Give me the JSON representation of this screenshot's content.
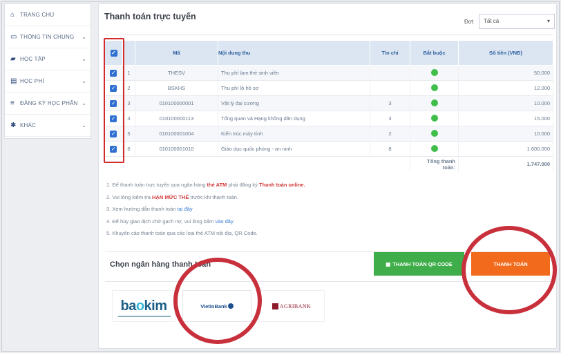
{
  "sidebar": {
    "items": [
      {
        "label": "TRANG CHỦ",
        "icon": "home-icon",
        "glyph": "⌂",
        "has_chevron": false
      },
      {
        "label": "THÔNG TIN CHUNG",
        "icon": "monitor-icon",
        "glyph": "▭",
        "has_chevron": true
      },
      {
        "label": "HỌC TẬP",
        "icon": "graduation-cap-icon",
        "glyph": "▰",
        "has_chevron": true
      },
      {
        "label": "HỌC PHÍ",
        "icon": "money-icon",
        "glyph": "▤",
        "has_chevron": true
      },
      {
        "label": "ĐĂNG KÝ HỌC PHẦN",
        "icon": "list-icon",
        "glyph": "≡",
        "has_chevron": true
      },
      {
        "label": "KHÁC",
        "icon": "gear-icon",
        "glyph": "✱",
        "has_chevron": true
      }
    ]
  },
  "page": {
    "title": "Thanh toán trực tuyến",
    "filter_label": "Đợt",
    "filter_value": "Tất cả"
  },
  "table": {
    "headers": [
      "",
      "",
      "Mã",
      "Nội dung thu",
      "Tín chỉ",
      "Bắt buộc",
      "Số tiền (VNĐ)"
    ],
    "rows": [
      {
        "stt": "1",
        "ma": "THESV",
        "noidung": "Thu phí làm thẻ sinh viên",
        "tinchi": "",
        "batbuoc": true,
        "sotien": "50.000"
      },
      {
        "stt": "2",
        "ma": "BSKHS",
        "noidung": "Thu phí lồ hồ sơ",
        "tinchi": "",
        "batbuoc": true,
        "sotien": "12.000"
      },
      {
        "stt": "3",
        "ma": "010100000001",
        "noidung": "Vật lý đại cương",
        "tinchi": "3",
        "batbuoc": true,
        "sotien": "10.000"
      },
      {
        "stt": "4",
        "ma": "010100000113",
        "noidung": "Tổng quan và Hạng không dân dụng",
        "tinchi": "3",
        "batbuoc": true,
        "sotien": "15.000"
      },
      {
        "stt": "5",
        "ma": "010100001004",
        "noidung": "Kiến trúc máy tính",
        "tinchi": "2",
        "batbuoc": true,
        "sotien": "10.000"
      },
      {
        "stt": "6",
        "ma": "010100001010",
        "noidung": "Giáo dục quốc phòng - an ninh",
        "tinchi": "8",
        "batbuoc": true,
        "sotien": "1.600.000"
      }
    ],
    "total_label": "Tổng thanh toán:",
    "total_value": "1.747.000"
  },
  "notes": {
    "n1_pre": "1. Để thanh toán trực tuyến qua ngân hàng ",
    "n1_red1": "thẻ ATM",
    "n1_mid": " phải đăng ký ",
    "n1_red2": "Thanh toán online.",
    "n2_pre": "2. Vui lòng kiểm tra ",
    "n2_red": "HẠN MỨC THẺ",
    "n2_post": " trước khi thanh toán.",
    "n3_pre": "3. Xem hướng dẫn thanh toán ",
    "n3_link": "tại đây",
    "n4_pre": "4. Để hủy giao dịch chờ gạch nợ, vui lòng bấm ",
    "n4_link": "vào đây",
    "n5": "5. Khuyến cáo thanh toán qua các loại thẻ ATM nội địa, QR Code."
  },
  "bank_section": {
    "title": "Chọn ngân hàng thanh toán",
    "qr_button": "THANH TOÁN QR CODE",
    "pay_button": "THANH TOÁN",
    "banks": {
      "baokim_pre": "ba",
      "baokim_o": "o",
      "baokim_post": "kim",
      "vietinbank": "VietinBank",
      "agribank": "AGRIBANK"
    }
  },
  "colors": {
    "annotation_red": "#c8303c",
    "qr_green": "#3fae4a",
    "pay_orange": "#f26a1b",
    "header_blue": "#dbe6f2"
  }
}
